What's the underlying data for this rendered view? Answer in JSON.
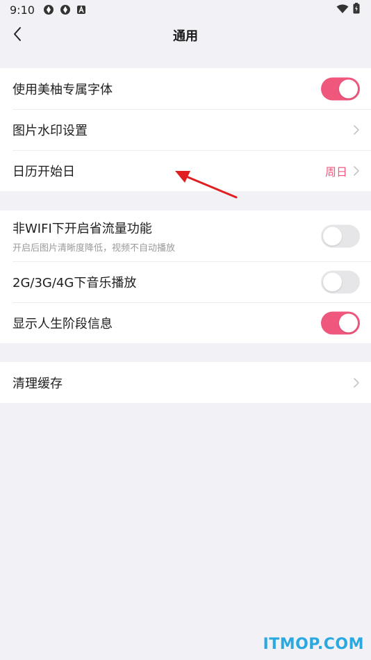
{
  "status_bar": {
    "time": "9:10",
    "icons": [
      "app-icon-1",
      "app-icon-2",
      "a-icon"
    ],
    "right_icons": [
      "wifi-icon",
      "battery-icon"
    ]
  },
  "nav": {
    "title": "通用",
    "back_icon": "chevron-left-icon"
  },
  "sections": [
    {
      "items": [
        {
          "label": "使用美柚专属字体",
          "control": "toggle",
          "on": true
        },
        {
          "label": "图片水印设置",
          "control": "chevron"
        },
        {
          "label": "日历开始日",
          "control": "chevron",
          "value": "周日"
        }
      ]
    },
    {
      "items": [
        {
          "label": "非WIFI下开启省流量功能",
          "sub": "开启后图片清晰度降低，视频不自动播放",
          "control": "toggle",
          "on": false
        },
        {
          "label": "2G/3G/4G下音乐播放",
          "control": "toggle",
          "on": false
        },
        {
          "label": "显示人生阶段信息",
          "control": "toggle",
          "on": true
        }
      ]
    },
    {
      "items": [
        {
          "label": "清理缓存",
          "control": "chevron"
        }
      ]
    }
  ],
  "colors": {
    "accent": "#f0577d",
    "background": "#f2f1f6",
    "toggle_off": "#e6e6e9",
    "annotation_arrow": "#e02020"
  },
  "watermark": "ITMOP.COM"
}
